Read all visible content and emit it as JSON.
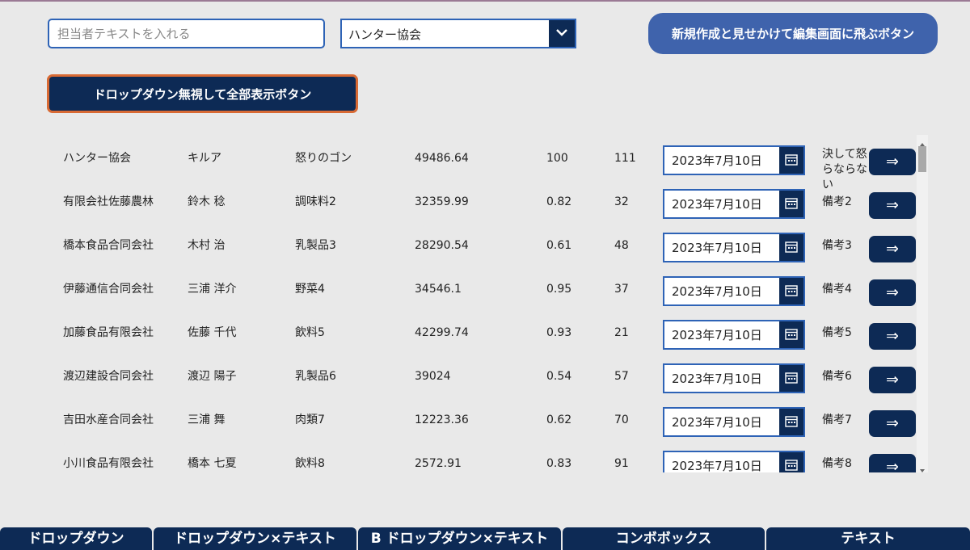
{
  "search": {
    "placeholder": "担当者テキストを入れる",
    "value": ""
  },
  "dropdown": {
    "selected": "ハンター協会",
    "icon": "chevron-down-icon"
  },
  "new_button": {
    "label": "新規作成と見せかけて編集画面に飛ぶボタン"
  },
  "show_all_button": {
    "label": "ドロップダウン無視して全部表示ボタン"
  },
  "rows": [
    {
      "company": "ハンター協会",
      "person": "キルア",
      "product": "怒りのゴン",
      "amount": "49486.64",
      "rate": "100",
      "qty": "111",
      "date": "2023年7月10日",
      "remark": "決して怒らならない",
      "action": "⇒"
    },
    {
      "company": "有限会社佐藤農林",
      "person": "鈴木 稔",
      "product": "調味料2",
      "amount": "32359.99",
      "rate": "0.82",
      "qty": "32",
      "date": "2023年7月10日",
      "remark": "備考2",
      "action": "⇒"
    },
    {
      "company": "橋本食品合同会社",
      "person": "木村 治",
      "product": "乳製品3",
      "amount": "28290.54",
      "rate": "0.61",
      "qty": "48",
      "date": "2023年7月10日",
      "remark": "備考3",
      "action": "⇒"
    },
    {
      "company": "伊藤通信合同会社",
      "person": "三浦 洋介",
      "product": "野菜4",
      "amount": "34546.1",
      "rate": "0.95",
      "qty": "37",
      "date": "2023年7月10日",
      "remark": "備考4",
      "action": "⇒"
    },
    {
      "company": "加藤食品有限会社",
      "person": "佐藤 千代",
      "product": "飲料5",
      "amount": "42299.74",
      "rate": "0.93",
      "qty": "21",
      "date": "2023年7月10日",
      "remark": "備考5",
      "action": "⇒"
    },
    {
      "company": "渡辺建設合同会社",
      "person": "渡辺 陽子",
      "product": "乳製品6",
      "amount": "39024",
      "rate": "0.54",
      "qty": "57",
      "date": "2023年7月10日",
      "remark": "備考6",
      "action": "⇒"
    },
    {
      "company": "吉田水産合同会社",
      "person": "三浦 舞",
      "product": "肉類7",
      "amount": "12223.36",
      "rate": "0.62",
      "qty": "70",
      "date": "2023年7月10日",
      "remark": "備考7",
      "action": "⇒"
    },
    {
      "company": "小川食品有限会社",
      "person": "橋本 七夏",
      "product": "飲料8",
      "amount": "2572.91",
      "rate": "0.83",
      "qty": "91",
      "date": "2023年7月10日",
      "remark": "備考8",
      "action": "⇒"
    }
  ],
  "tabs": [
    {
      "label": "ドロップダウン"
    },
    {
      "label": "ドロップダウン×テキスト"
    },
    {
      "label": "B ドロップダウン×テキスト"
    },
    {
      "label": "コンボボックス"
    },
    {
      "label": "テキスト"
    }
  ],
  "colors": {
    "navy": "#0d2a55",
    "accent_blue": "#3f63ac",
    "border_blue": "#2e63b6",
    "orange_border": "#d86a34",
    "background": "#e9e9e9"
  }
}
